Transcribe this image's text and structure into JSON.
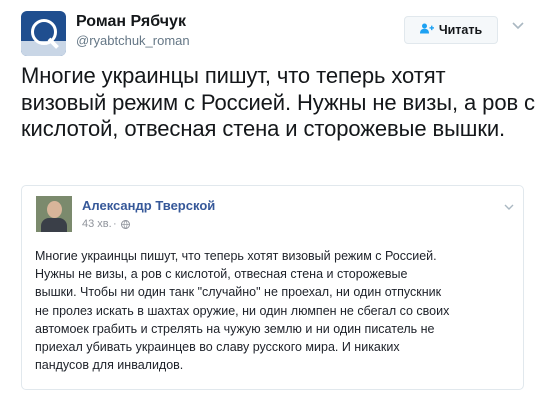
{
  "tweet": {
    "author_name": "Роман Рябчук",
    "author_handle": "@ryabtchuk_roman",
    "follow_label": "Читать",
    "text": "Многие украинцы пишут, что теперь хотят визовый режим с Россией. Нужны не визы, а ров с кислотой, отвесная стена и сторожевые вышки."
  },
  "embedded_post": {
    "author_name": "Александр Тверской",
    "time": "43 хв.",
    "separator": "·",
    "lines": [
      "Многие украинцы пишут, что теперь хотят визовый режим с Россией.",
      "Нужны не визы, а ров с кислотой, отвесная стена и сторожевые",
      "вышки. Чтобы ни один танк \"случайно\" не проехал, ни один отпускник",
      "не пролез искать в шахтах оружие, ни один люмпен не сбегал со своих",
      "автомоек грабить и стрелять на чужую землю и ни один писатель не",
      "приехал убивать украинцев во славу русского мира. И никаких",
      "пандусов для инвалидов."
    ]
  },
  "icons": {
    "follow": "add-user-icon",
    "menu": "chevron-down-icon",
    "privacy": "globe-icon"
  },
  "colors": {
    "accent": "#1da1f2",
    "fb_link": "#365899"
  }
}
